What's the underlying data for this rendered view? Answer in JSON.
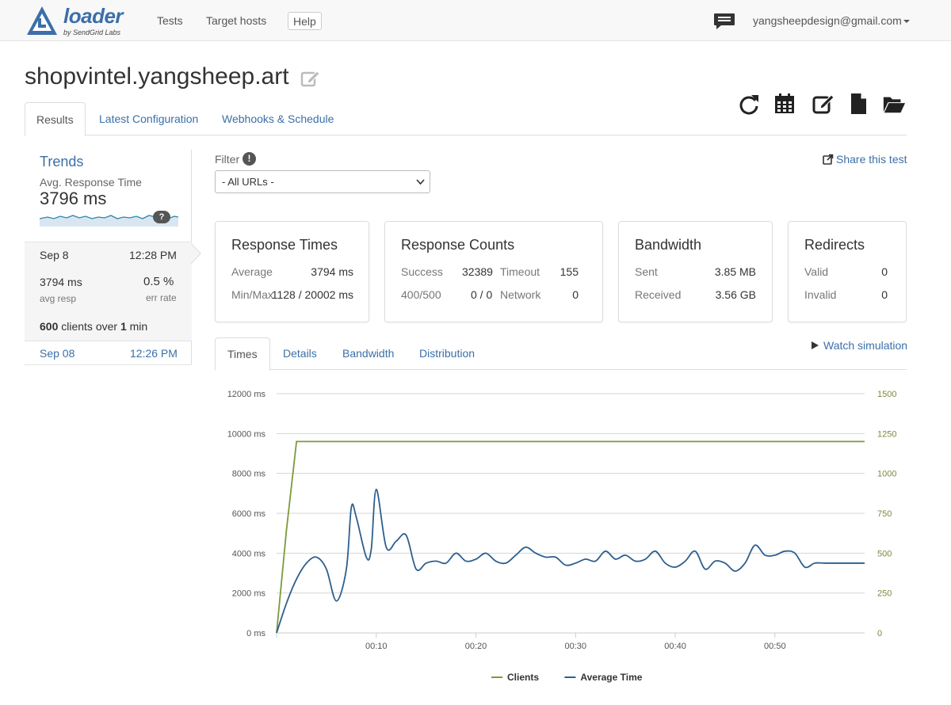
{
  "brand": {
    "name": "loader",
    "tagline": "by SendGrid Labs",
    "color": "#3b6fa8"
  },
  "nav": {
    "tests": "Tests",
    "target_hosts": "Target hosts",
    "help": "Help",
    "user_email": "yangsheepdesign@gmail.com"
  },
  "page": {
    "title": "shopvintel.yangsheep.art"
  },
  "toolbar_icons": [
    "refresh-icon",
    "calendar-icon",
    "edit-icon",
    "document-icon",
    "folder-open-icon"
  ],
  "tabs": [
    {
      "label": "Results",
      "active": true
    },
    {
      "label": "Latest Configuration",
      "active": false
    },
    {
      "label": "Webhooks & Schedule",
      "active": false
    }
  ],
  "trends": {
    "title": "Trends",
    "metric_label": "Avg. Response Time",
    "metric_value": "3796 ms",
    "help_badge": "?"
  },
  "runs": {
    "active": {
      "date": "Sep 8",
      "time": "12:28 PM",
      "avg_resp_value": "3794 ms",
      "avg_resp_label": "avg resp",
      "err_rate_value": "0.5 %",
      "err_rate_label": "err rate",
      "clients_count": "600",
      "clients_text_a": "clients over",
      "duration": "1",
      "duration_unit": "min"
    },
    "other": {
      "date": "Sep 08",
      "time": "12:26 PM"
    }
  },
  "filter": {
    "label": "Filter",
    "info": "!",
    "selected": "- All URLs -"
  },
  "share": {
    "label": "Share this test"
  },
  "cards": {
    "response_times": {
      "title": "Response Times",
      "average_label": "Average",
      "average_value": "3794 ms",
      "minmax_label": "Min/Max",
      "minmax_value": "1128 / 20002 ms"
    },
    "response_counts": {
      "title": "Response Counts",
      "success_label": "Success",
      "success_value": "32389",
      "timeout_label": "Timeout",
      "timeout_value": "155",
      "errors_label": "400/500",
      "errors_value": "0 / 0",
      "network_label": "Network",
      "network_value": "0"
    },
    "bandwidth": {
      "title": "Bandwidth",
      "sent_label": "Sent",
      "sent_value": "3.85 MB",
      "received_label": "Received",
      "received_value": "3.56 GB"
    },
    "redirects": {
      "title": "Redirects",
      "valid_label": "Valid",
      "valid_value": "0",
      "invalid_label": "Invalid",
      "invalid_value": "0"
    }
  },
  "chart_tabs": [
    {
      "label": "Times",
      "active": true
    },
    {
      "label": "Details",
      "active": false
    },
    {
      "label": "Bandwidth",
      "active": false
    },
    {
      "label": "Distribution",
      "active": false
    }
  ],
  "watch_simulation": "Watch simulation",
  "chart_data": {
    "type": "line",
    "title": "",
    "xlabel": "",
    "ylabel": "",
    "x_ticks": [
      "00:10",
      "00:20",
      "00:30",
      "00:40",
      "00:50"
    ],
    "y_left_ticks": [
      "0 ms",
      "2000 ms",
      "4000 ms",
      "6000 ms",
      "8000 ms",
      "10000 ms",
      "12000 ms"
    ],
    "y_right_ticks": [
      "0",
      "250",
      "500",
      "750",
      "1000",
      "1250",
      "1500"
    ],
    "ylim_left": [
      0,
      12000
    ],
    "ylim_right": [
      0,
      1500
    ],
    "xlim": [
      0,
      59
    ],
    "grid": true,
    "legend_position": "bottom",
    "series": [
      {
        "name": "Clients",
        "axis": "right",
        "color": "#7c9a3c",
        "x": [
          0,
          1,
          2,
          59
        ],
        "y": [
          0,
          650,
          1200,
          1200
        ]
      },
      {
        "name": "Average Time",
        "axis": "left",
        "color": "#2d5f8e",
        "x": [
          0,
          1,
          2,
          3,
          4,
          5,
          6,
          7,
          7.5,
          8,
          9,
          9.5,
          10,
          11,
          12,
          13,
          14,
          15,
          16,
          17,
          18,
          19,
          20,
          21,
          22,
          23,
          24,
          25,
          26,
          27,
          28,
          29,
          30,
          31,
          32,
          33,
          34,
          35,
          36,
          37,
          38,
          39,
          40,
          41,
          42,
          43,
          44,
          45,
          46,
          47,
          48,
          49,
          50,
          51,
          52,
          53,
          54,
          55,
          56,
          57,
          58,
          59
        ],
        "y": [
          0,
          1500,
          2700,
          3500,
          3800,
          3200,
          1600,
          3200,
          6300,
          5800,
          3800,
          4200,
          7200,
          4300,
          4600,
          4900,
          3200,
          3500,
          3600,
          3500,
          4000,
          3600,
          3700,
          4000,
          3600,
          3500,
          3900,
          4300,
          4000,
          3800,
          3800,
          3400,
          3500,
          3700,
          3600,
          4100,
          3700,
          3900,
          3600,
          3700,
          4100,
          3500,
          3300,
          3600,
          4100,
          3200,
          3600,
          3500,
          3100,
          3500,
          4400,
          3900,
          3900,
          4100,
          4000,
          3300,
          3500,
          3500,
          3500,
          3500,
          3500,
          3500
        ]
      }
    ]
  }
}
